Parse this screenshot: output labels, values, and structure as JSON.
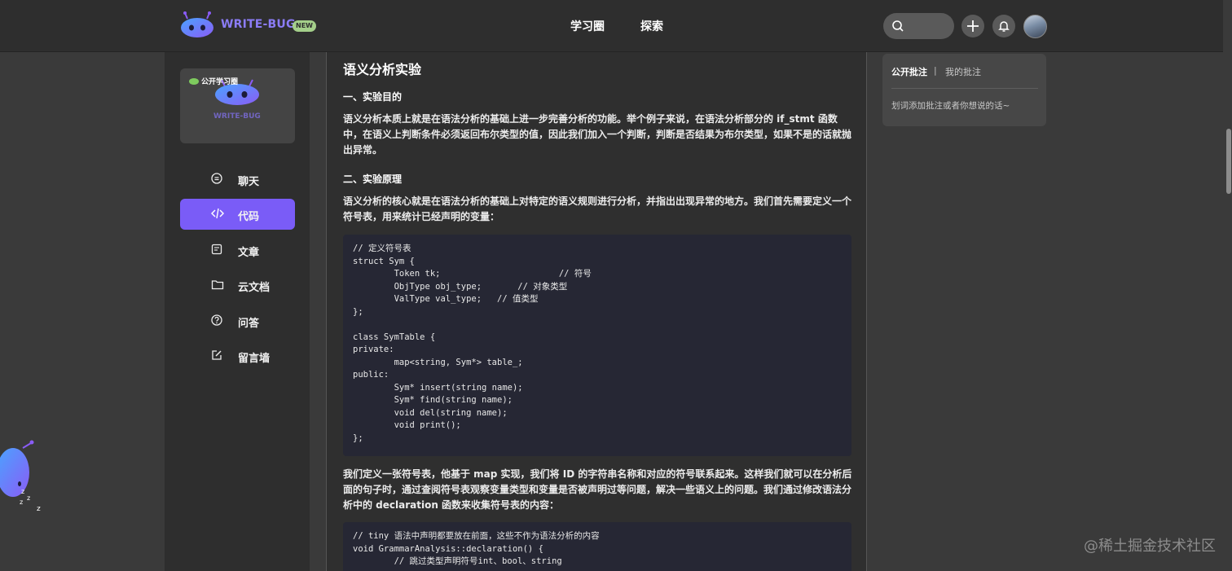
{
  "header": {
    "brand": "WRITE-BUG",
    "new_badge": "NEW",
    "nav": [
      "学习圈",
      "探索"
    ],
    "icons": [
      "search-icon",
      "plus-icon",
      "bell-icon"
    ]
  },
  "sidebar": {
    "circle_label": "公开学习圈",
    "card_brand": "WRITE-BUG",
    "items": [
      {
        "label": "聊天",
        "icon": "chat-icon",
        "active": false
      },
      {
        "label": "代码",
        "icon": "code-icon",
        "active": true
      },
      {
        "label": "文章",
        "icon": "article-icon",
        "active": false
      },
      {
        "label": "云文档",
        "icon": "folder-icon",
        "active": false
      },
      {
        "label": "问答",
        "icon": "question-icon",
        "active": false
      },
      {
        "label": "留言墙",
        "icon": "edit-icon",
        "active": false
      }
    ]
  },
  "article": {
    "title": "语义分析实验",
    "section1_heading": "一、实验目的",
    "section1_body": "语义分析本质上就是在语法分析的基础上进一步完善分析的功能。举个例子来说，在语法分析部分的 if_stmt 函数中，在语义上判断条件必须返回布尔类型的值，因此我们加入一个判断，判断是否结果为布尔类型，如果不是的话就抛出异常。",
    "section2_heading": "二、实验原理",
    "section2_body": "语义分析的核心就是在语法分析的基础上对特定的语义规则进行分析，并指出出现异常的地方。我们首先需要定义一个符号表，用来统计已经声明的变量：",
    "code1": "// 定义符号表\nstruct Sym {\n        Token tk;                       // 符号\n        ObjType obj_type;       // 对象类型\n        ValType val_type;   // 值类型\n};\n\nclass SymTable {\nprivate:\n        map<string, Sym*> table_;\npublic:\n        Sym* insert(string name);\n        Sym* find(string name);\n        void del(string name);\n        void print();\n};",
    "body3": "我们定义一张符号表，他基于 map 实现，我们将 ID 的字符串名称和对应的符号联系起来。这样我们就可以在分析后面的句子时，通过查阅符号表观察变量类型和变量是否被声明过等问题，解决一些语义上的问题。我们通过修改语法分析中的 declaration 函数来收集符号表的内容：",
    "code2": "// tiny 语法中声明都要放在前面，这些不作为语法分析的内容\nvoid GrammarAnalysis::declaration() {\n        // 跳过类型声明符号int、bool、string"
  },
  "notes": {
    "tab_public": "公开批注",
    "separator": "|",
    "tab_mine": "我的批注",
    "hint": "划词添加批注或者你想说的话~"
  },
  "watermark": "@稀土掘金技术社区",
  "colors": {
    "accent": "#7a5cf7",
    "brand_text": "#8b7cf6",
    "badge": "#a4cf8a"
  }
}
